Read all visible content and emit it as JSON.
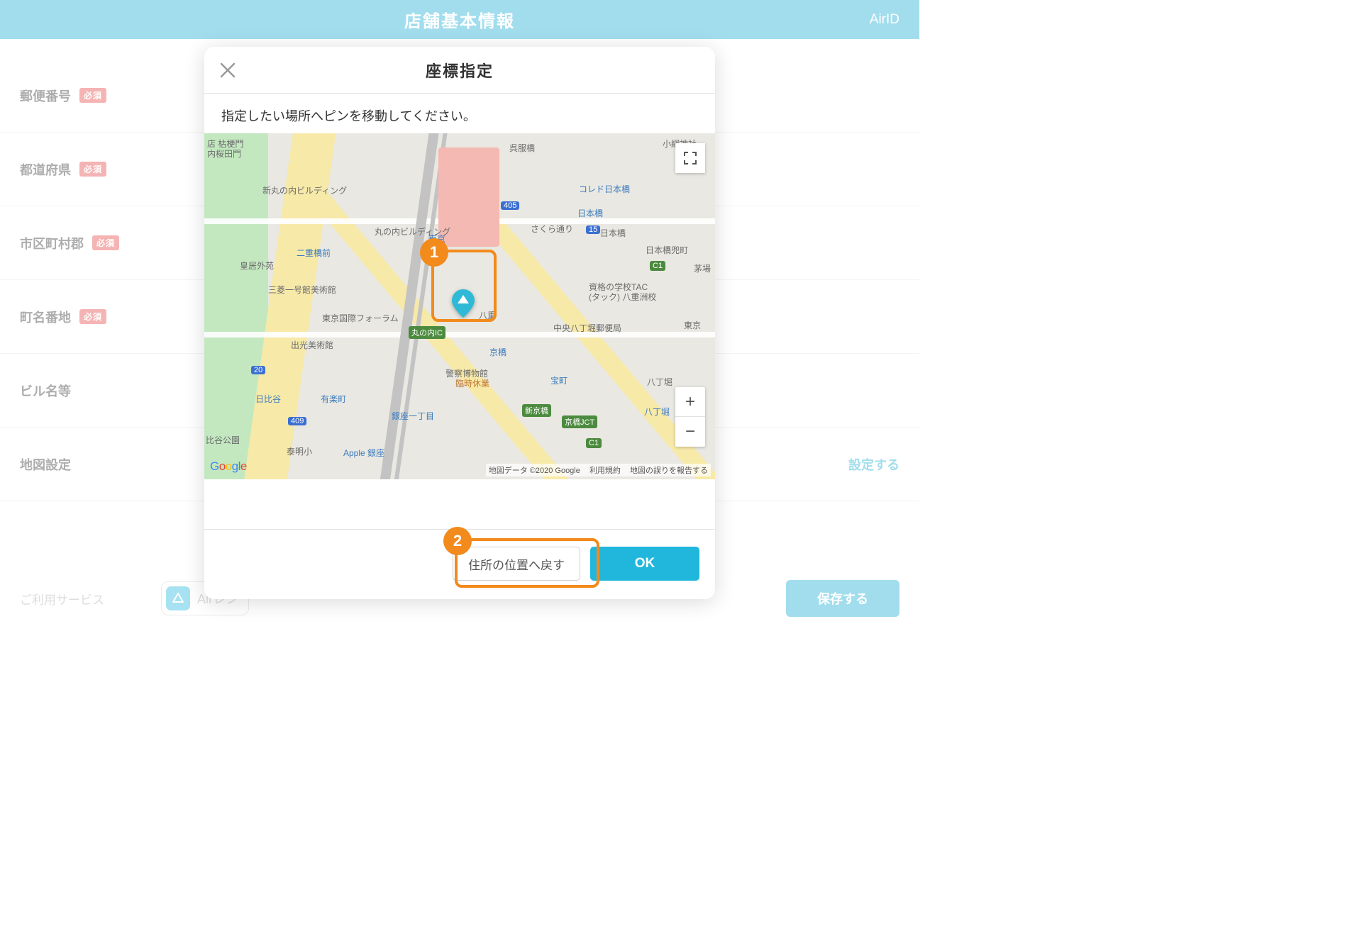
{
  "header": {
    "title": "店舗基本情報",
    "right": "AirID"
  },
  "form": {
    "rows": [
      {
        "label": "郵便番号",
        "required": true
      },
      {
        "label": "都道府県",
        "required": true
      },
      {
        "label": "市区町村郡",
        "required": true
      },
      {
        "label": "町名番地",
        "required": true
      },
      {
        "label": "ビル名等",
        "required": false
      },
      {
        "label": "地図設定",
        "required": false,
        "action": "設定する"
      }
    ],
    "required_badge": "必須"
  },
  "bottom": {
    "service_label": "ご利用サービス",
    "chip": "Airレジ",
    "save": "保存する"
  },
  "modal": {
    "title": "座標指定",
    "instruction": "指定したい場所へピンを移動してください。",
    "reset_button": "住所の位置へ戻す",
    "ok_button": "OK",
    "attribution_data": "地図データ ©2020 Google",
    "attribution_terms": "利用規約",
    "attribution_report": "地図の誤りを報告する",
    "map_labels": {
      "shin_marunouchi": "新丸の内ビルディング",
      "marunouchi_bldg": "丸の内ビルディング",
      "tokyo": "東京",
      "nijubashimae": "二重橋前",
      "kokyogaien": "皇居外苑",
      "mitsubishi": "三菱一号館美術館",
      "tif": "東京国際フォーラム",
      "idemitsu": "出光美術館",
      "hibiya": "日比谷",
      "yurakucho": "有楽町",
      "ginza1": "銀座一丁目",
      "taimei": "泰明小",
      "apple": "Apple 銀座",
      "police_museum": "警察博物館",
      "police_museum_sub": "臨時休業",
      "kyobashi": "京橋",
      "coredo": "コレド日本橋",
      "nihombashi_sta": "日本橋",
      "nihombashi": "日本橋",
      "sakura": "さくら通り",
      "tac1": "資格の学校TAC",
      "tac2": "(タック) 八重洲校",
      "chuo_post": "中央八丁堀郵便局",
      "takaracho": "宝町",
      "hatchobori": "八丁堀",
      "shinkyobashi": "新京橋",
      "kyobashi_jct": "京橋JCT",
      "marunouchi_ic": "丸の内IC",
      "gofukubashi": "呉服橋",
      "yaesu": "八重",
      "uchisakurada": "内桜田門",
      "hibiya_park": "比谷公園",
      "hakozaki": "店 枯梗門",
      "koami": "小網神社",
      "kayabacho": "茅場",
      "nihombashi_end": "日本橋兜町",
      "higashi": "東京",
      "r20": "20",
      "r409": "409",
      "r405": "405",
      "r15": "15",
      "c1a": "C1",
      "c1b": "C1"
    }
  },
  "callouts": {
    "one": "1",
    "two": "2"
  }
}
